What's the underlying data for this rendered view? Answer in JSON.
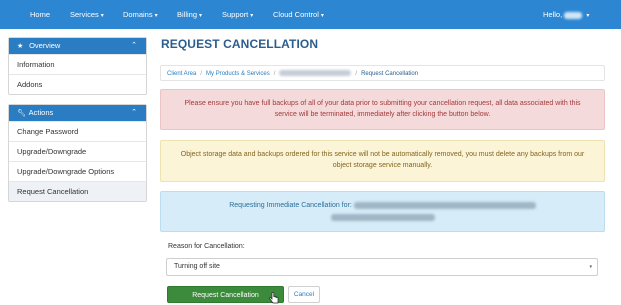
{
  "nav": {
    "items": [
      {
        "label": "Home",
        "caret": ""
      },
      {
        "label": "Services",
        "caret": "▾"
      },
      {
        "label": "Domains",
        "caret": "▾"
      },
      {
        "label": "Billing",
        "caret": "▾"
      },
      {
        "label": "Support",
        "caret": "▾"
      },
      {
        "label": "Cloud Control",
        "caret": "▾"
      }
    ],
    "user_greeting": "Hello,",
    "user_caret": "▾",
    "color": "#2d86d1"
  },
  "sidebar": {
    "overview": {
      "title": "Overview",
      "icon": "star-icon",
      "collapse_glyph": "⌃",
      "items": [
        {
          "label": "Information"
        },
        {
          "label": "Addons"
        }
      ]
    },
    "actions": {
      "title": "Actions",
      "icon": "wrench-icon",
      "collapse_glyph": "⌃",
      "items": [
        {
          "label": "Change Password"
        },
        {
          "label": "Upgrade/Downgrade"
        },
        {
          "label": "Upgrade/Downgrade Options"
        },
        {
          "label": "Request Cancellation",
          "active": true
        }
      ]
    }
  },
  "page": {
    "title": "REQUEST CANCELLATION"
  },
  "breadcrumb": {
    "items": [
      {
        "label": "Client Area"
      },
      {
        "label": "My Products & Services"
      }
    ],
    "current": "Request Cancellation",
    "separator": "/"
  },
  "alerts": {
    "danger": "Please ensure you have full backups of all of your data prior to submitting your cancellation request, all data associated with this service will be terminated, immediately after clicking the button below.",
    "warning": "Object storage data and backups ordered for this service will not be automatically removed, you must delete any backups from our object storage service manually.",
    "info": "Requesting Immediate Cancellation for:"
  },
  "form": {
    "reason_label": "Reason for Cancellation:",
    "reason_value": "Turning off site",
    "select_arrow": "▾",
    "submit_label": "Request Cancellation",
    "cancel_label": "Cancel"
  },
  "colors": {
    "accent": "#2a7dc2",
    "submit": "#3c8a3c",
    "danger_bg": "#f5dadb",
    "warning_bg": "#fcf4d7",
    "info_bg": "#d6ecf8"
  }
}
